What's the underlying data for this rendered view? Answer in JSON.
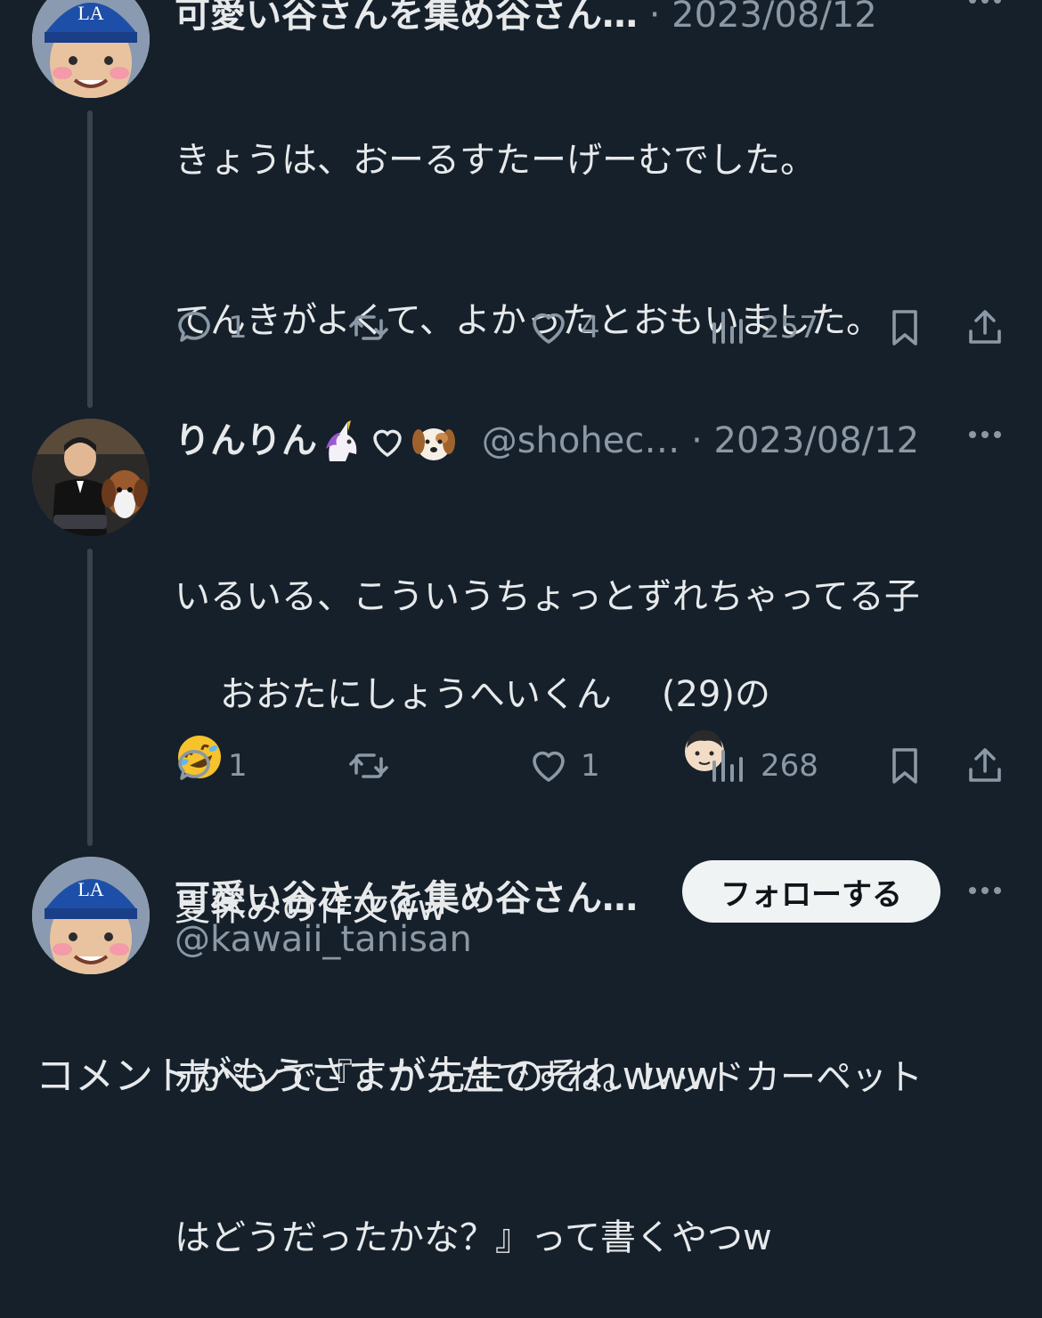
{
  "tweet1": {
    "name": "可愛い谷さんを集め谷さん…",
    "date": "· 2023/08/12",
    "line1": "きょうは、おーるすたーげーむでした。",
    "line2": "てんきがよくて、よかったとおもいました。",
    "line3a": "おおたにしょうへいくん",
    "line3b": "(29)の",
    "line4": "夏休みの作文ww",
    "replies": "1",
    "likes": "4",
    "views": "257"
  },
  "tweet2": {
    "name": "りんりん",
    "handle": "@shohec…",
    "date": "· 2023/08/12",
    "line1": "いるいる、こういうちょっとずれちゃってる子",
    "line3": "赤ペンで『よかったですね。レッドカーペット",
    "line4": "はどうだったかな？』って書くやつw",
    "replies": "1",
    "likes": "1",
    "views": "268"
  },
  "profile": {
    "name": "可愛い谷さんを集め谷さん…",
    "handle": "@kawaii_tanisan",
    "follow_label": "フォローする"
  },
  "comment": "コメントがもうさすが先生のそれwww",
  "colors": {
    "background": "#15202b",
    "text": "#e7e9ea",
    "muted": "#8b98a5",
    "button": "#eff3f4"
  },
  "icons": [
    "reply-icon",
    "retweet-icon",
    "like-icon",
    "views-icon",
    "bookmark-icon",
    "share-icon",
    "more-icon"
  ]
}
